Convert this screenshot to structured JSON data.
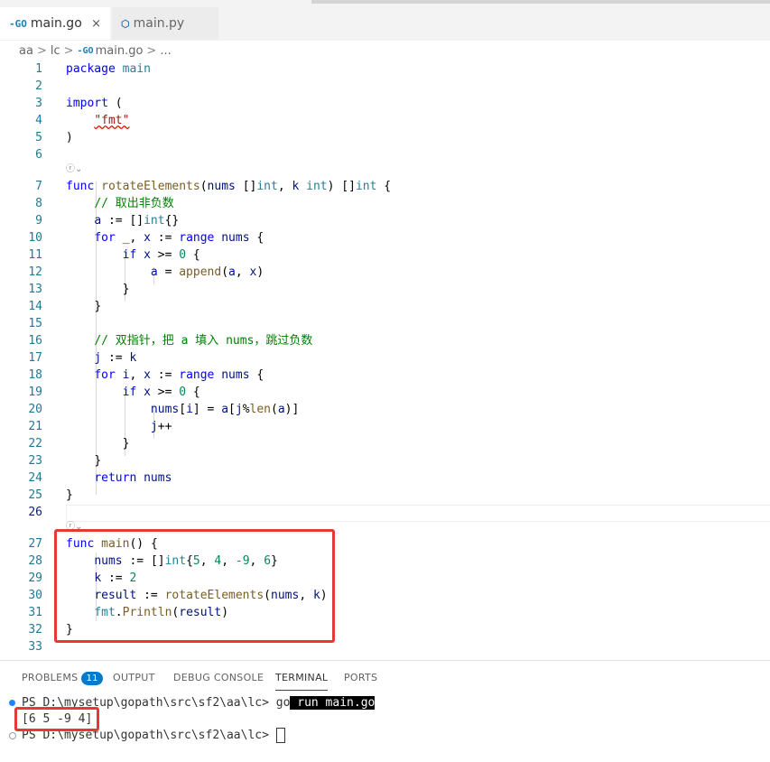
{
  "tabs": [
    {
      "icon": "-GO",
      "label": "main.go"
    },
    {
      "icon": "⬡",
      "label": "main.py"
    }
  ],
  "tab_close": "×",
  "breadcrumb": {
    "parts": [
      "aa",
      "lc"
    ],
    "file_icon": "-GO",
    "file": "main.go",
    "trail": "...",
    "sep": ">"
  },
  "editor": {
    "line_numbers": [
      "1",
      "2",
      "3",
      "4",
      "5",
      "6",
      "7",
      "8",
      "9",
      "10",
      "11",
      "12",
      "13",
      "14",
      "15",
      "16",
      "17",
      "18",
      "19",
      "20",
      "21",
      "22",
      "23",
      "24",
      "25",
      "26",
      "27",
      "28",
      "29",
      "30",
      "31",
      "32",
      "33"
    ],
    "codelens": "ⓡ⌄",
    "tokens": {
      "l1": [
        "package",
        "main"
      ],
      "l3": [
        "import",
        "("
      ],
      "l4": "\"fmt\"",
      "l5": ")",
      "l7": [
        "func",
        "rotateElements",
        "(",
        "nums",
        "[]",
        "int",
        ",",
        "k",
        "int",
        ")",
        "[]",
        "int",
        "{"
      ],
      "l8": "// 取出非负数",
      "l9": [
        "a",
        ":=",
        "[]",
        "int",
        "{}"
      ],
      "l10": [
        "for",
        "_",
        ",",
        "x",
        ":=",
        "range",
        "nums",
        "{"
      ],
      "l11": [
        "if",
        "x",
        ">=",
        "0",
        "{"
      ],
      "l12": [
        "a",
        "=",
        "append",
        "(",
        "a",
        ",",
        "x",
        ")"
      ],
      "l13": "}",
      "l14": "}",
      "l16": "// 双指针，把 a 填入 nums，跳过负数",
      "l17": [
        "j",
        ":=",
        "k"
      ],
      "l18": [
        "for",
        "i",
        ",",
        "x",
        ":=",
        "range",
        "nums",
        "{"
      ],
      "l19": [
        "if",
        "x",
        ">=",
        "0",
        "{"
      ],
      "l20": [
        "nums",
        "[",
        "i",
        "]",
        "=",
        "a",
        "[",
        "j",
        "%",
        "len",
        "(",
        "a",
        ")",
        "]"
      ],
      "l21": [
        "j",
        "++"
      ],
      "l22": "}",
      "l23": "}",
      "l24": [
        "return",
        "nums"
      ],
      "l25": "}",
      "l27": [
        "func",
        "main",
        "()",
        "{"
      ],
      "l28": [
        "nums",
        ":=",
        "[]",
        "int",
        "{",
        "5",
        ",",
        "4",
        ",",
        "-9",
        ",",
        "6",
        "}"
      ],
      "l29": [
        "k",
        ":=",
        "2"
      ],
      "l30": [
        "result",
        ":=",
        "rotateElements",
        "(",
        "nums",
        ",",
        "k",
        ")"
      ],
      "l31": [
        "fmt",
        ".",
        "Println",
        "(",
        "result",
        ")"
      ],
      "l32": "}"
    }
  },
  "panel": {
    "tabs": [
      "PROBLEMS",
      "OUTPUT",
      "DEBUG CONSOLE",
      "TERMINAL",
      "PORTS"
    ],
    "problems_count": "11",
    "terminal": {
      "prompt1": "PS D:\\mysetup\\gopath\\src\\sf2\\aa\\lc> ",
      "cmd_go": "go",
      "cmd_rest": " run main.go",
      "output": "[6 5 -9 4]",
      "prompt2": "PS D:\\mysetup\\gopath\\src\\sf2\\aa\\lc> "
    }
  },
  "colors": {
    "accent": "#007acc",
    "highlight_box": "#e53935",
    "keyword": "#0000ff",
    "type": "#267f99",
    "function": "#795e26",
    "number": "#098658",
    "comment": "#008000"
  }
}
